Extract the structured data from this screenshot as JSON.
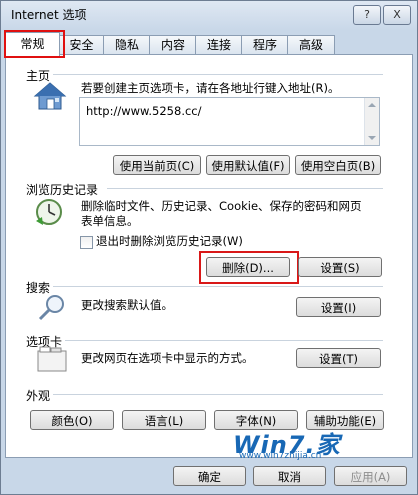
{
  "window": {
    "title": "Internet 选项",
    "help_label": "?",
    "close_label": "X"
  },
  "tabs": [
    {
      "label": "常规"
    },
    {
      "label": "安全"
    },
    {
      "label": "隐私"
    },
    {
      "label": "内容"
    },
    {
      "label": "连接"
    },
    {
      "label": "程序"
    },
    {
      "label": "高级"
    }
  ],
  "homepage": {
    "heading": "主页",
    "desc": "若要创建主页选项卡，请在各地址行键入地址(R)。",
    "url": "http://www.5258.cc/",
    "btn_current": "使用当前页(C)",
    "btn_default": "使用默认值(F)",
    "btn_blank": "使用空白页(B)"
  },
  "history": {
    "heading": "浏览历史记录",
    "desc": "删除临时文件、历史记录、Cookie、保存的密码和网页表单信息。",
    "checkbox_label": "退出时删除浏览历史记录(W)",
    "btn_delete": "删除(D)...",
    "btn_settings": "设置(S)"
  },
  "search": {
    "heading": "搜索",
    "desc": "更改搜索默认值。",
    "btn_settings": "设置(I)"
  },
  "tabs_section": {
    "heading": "选项卡",
    "desc": "更改网页在选项卡中显示的方式。",
    "btn_settings": "设置(T)"
  },
  "appearance": {
    "heading": "外观",
    "btn_colors": "颜色(O)",
    "btn_languages": "语言(L)",
    "btn_fonts": "字体(N)",
    "btn_accessibility": "辅助功能(E)"
  },
  "footer": {
    "btn_ok": "确定",
    "btn_cancel": "取消",
    "btn_apply": "应用(A)"
  },
  "watermark": {
    "logo": "Win7.家",
    "url": "www.win7zhijia.cn"
  }
}
